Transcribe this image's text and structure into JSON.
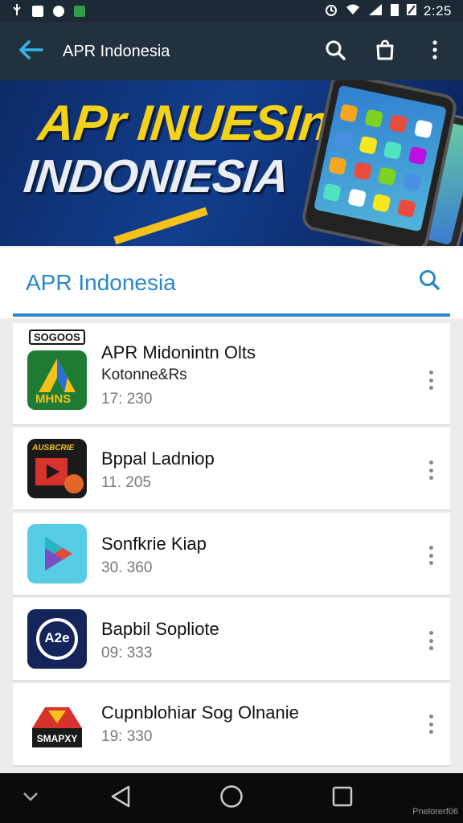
{
  "status_bar": {
    "time": "2:25"
  },
  "app_bar": {
    "title": "APR Indonesia"
  },
  "banner": {
    "line1": "APr INUESInA",
    "line2": "INDONIESIA"
  },
  "search_section": {
    "title": "APR Indonesia"
  },
  "apps": [
    {
      "tag": "SOGOOS",
      "title": "APR Midonintn Olts",
      "subtitle": "Kotonne&Rs",
      "meta": "17: 230",
      "icon_label": "MHNS",
      "icon": "triangle-logo-icon"
    },
    {
      "title": "Bppal Ladniop",
      "meta": "11. 205",
      "icon_label": "AUSBCRIE",
      "icon": "play-frame-icon"
    },
    {
      "title": "Sonfkrie Kiap",
      "meta": "30. 360",
      "icon": "play-store-icon"
    },
    {
      "title": "Bapbil Sopliote",
      "meta": "09: 333",
      "icon_label": "A2e",
      "icon": "badge-logo-icon"
    },
    {
      "title": "Cupnblohiar Sog Olnanie",
      "meta": "19: 330",
      "icon_label": "SMAPXY",
      "icon": "envelope-logo-icon"
    }
  ],
  "watermark": "Pnelorerf06"
}
